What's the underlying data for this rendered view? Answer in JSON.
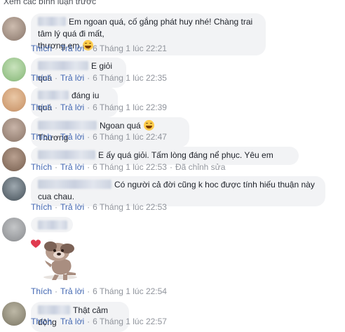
{
  "header": {
    "view_previous": "Xem các bình luận trước"
  },
  "actions": {
    "like": "Thích",
    "reply": "Trả lời",
    "dot": "·"
  },
  "comments": [
    {
      "text_line1": "Em ngoan quá, cố gắng phát huy nhé! Chàng trai tâm lý quá đi mất,",
      "text_line2": "thương em",
      "emoji": "grinning-face",
      "time": "6 Tháng 1 lúc 22:21",
      "avatar_color": "#b9a79a"
    },
    {
      "text": "E giỏi quá",
      "time": "6 Tháng 1 lúc 22:35",
      "avatar_color": "#9cc48f"
    },
    {
      "text": "đáng iu quá",
      "time": "6 Tháng 1 lúc 22:39",
      "avatar_color": "#d3a37a"
    },
    {
      "text": "Ngoan quá",
      "text_after": "Thương",
      "emoji": "grinning-face",
      "time": "6 Tháng 1 lúc 22:47",
      "avatar_color": "#a08c80"
    },
    {
      "text": "E ấy quá giỏi. Tấm lòng đáng nể phục. Yêu em",
      "time": "6 Tháng 1 lúc 22:53",
      "edited": "Đã chỉnh sửa",
      "avatar_color": "#8a7466"
    },
    {
      "text_line1": "Có người cả đời cũng k hoc được tính hiếu thuận này",
      "text_line2": "cua chau.",
      "time": "6 Tháng 1 lúc 22:53",
      "avatar_color": "#5f6a72"
    },
    {
      "sticker": "puppy-with-heart",
      "time": "6 Tháng 1 lúc 22:54",
      "avatar_color": "#9a9c9f"
    },
    {
      "text": "Thật cảm động",
      "time": "6 Tháng 1 lúc 22:57",
      "avatar_color": "#8f8a78"
    }
  ]
}
